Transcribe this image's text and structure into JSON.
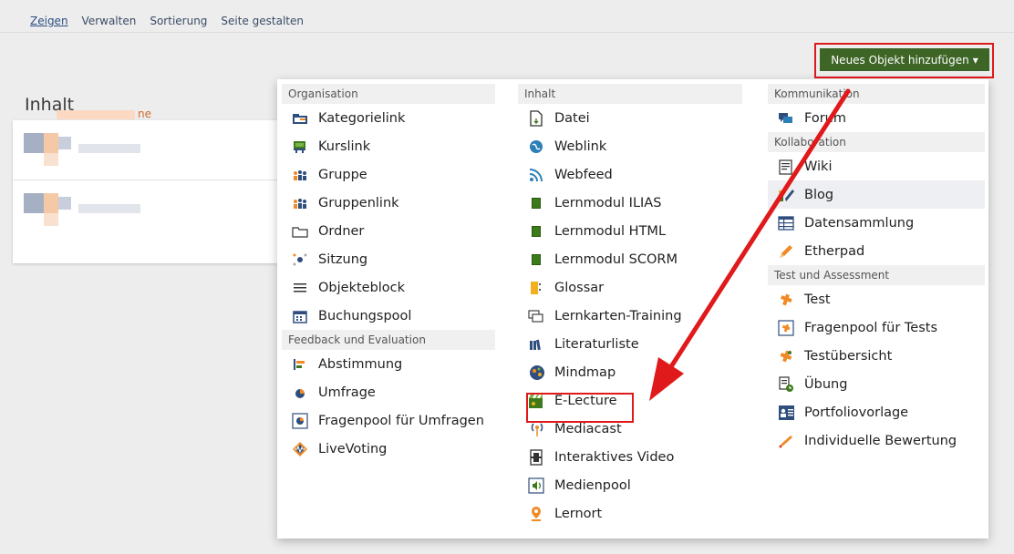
{
  "tabs": [
    "Zeigen",
    "Verwalten",
    "Sortierung",
    "Seite gestalten"
  ],
  "add_button": {
    "label": "Neues Objekt hinzufügen",
    "caret": "▾"
  },
  "page_title": "Inhalt",
  "content_row_suffix": "ne",
  "colors": {
    "accent_button": "#3d6526",
    "highlight": "#e0191b"
  },
  "menu": {
    "col1": [
      {
        "header": "Organisation",
        "items": [
          {
            "label": "Kategorielink",
            "icon": "category-link-icon"
          },
          {
            "label": "Kurslink",
            "icon": "course-link-icon"
          },
          {
            "label": "Gruppe",
            "icon": "group-icon"
          },
          {
            "label": "Gruppenlink",
            "icon": "group-link-icon"
          },
          {
            "label": "Ordner",
            "icon": "folder-icon"
          },
          {
            "label": "Sitzung",
            "icon": "session-icon"
          },
          {
            "label": "Objekteblock",
            "icon": "item-group-icon"
          },
          {
            "label": "Buchungspool",
            "icon": "booking-pool-icon"
          }
        ]
      },
      {
        "header": "Feedback und Evaluation",
        "items": [
          {
            "label": "Abstimmung",
            "icon": "poll-icon"
          },
          {
            "label": "Umfrage",
            "icon": "survey-icon"
          },
          {
            "label": "Fragenpool für Umfragen",
            "icon": "survey-pool-icon"
          },
          {
            "label": "LiveVoting",
            "icon": "live-voting-icon"
          }
        ]
      }
    ],
    "col2": [
      {
        "header": "Inhalt",
        "items": [
          {
            "label": "Datei",
            "icon": "file-icon"
          },
          {
            "label": "Weblink",
            "icon": "weblink-icon"
          },
          {
            "label": "Webfeed",
            "icon": "rss-icon"
          },
          {
            "label": "Lernmodul ILIAS",
            "icon": "learning-module-icon"
          },
          {
            "label": "Lernmodul HTML",
            "icon": "learning-module-icon"
          },
          {
            "label": "Lernmodul SCORM",
            "icon": "learning-module-icon"
          },
          {
            "label": "Glossar",
            "icon": "glossary-icon"
          },
          {
            "label": "Lernkarten-Training",
            "icon": "flashcards-icon"
          },
          {
            "label": "Literaturliste",
            "icon": "bibliography-icon"
          },
          {
            "label": "Mindmap",
            "icon": "mindmap-icon"
          },
          {
            "label": "E-Lecture",
            "icon": "electure-icon"
          },
          {
            "label": "Mediacast",
            "icon": "mediacast-icon"
          },
          {
            "label": "Interaktives Video",
            "icon": "video-icon"
          },
          {
            "label": "Medienpool",
            "icon": "media-pool-icon"
          },
          {
            "label": "Lernort",
            "icon": "location-icon"
          }
        ]
      }
    ],
    "col3": [
      {
        "header": "Kommunikation",
        "items": [
          {
            "label": "Forum",
            "icon": "forum-icon"
          }
        ]
      },
      {
        "header": "Kollaboration",
        "items": [
          {
            "label": "Wiki",
            "icon": "wiki-icon"
          },
          {
            "label": "Blog",
            "icon": "blog-icon"
          },
          {
            "label": "Datensammlung",
            "icon": "data-collection-icon"
          },
          {
            "label": "Etherpad",
            "icon": "etherpad-icon"
          }
        ]
      },
      {
        "header": "Test und Assessment",
        "items": [
          {
            "label": "Test",
            "icon": "test-icon"
          },
          {
            "label": "Fragenpool für Tests",
            "icon": "question-pool-icon"
          },
          {
            "label": "Testübersicht",
            "icon": "test-overview-icon"
          },
          {
            "label": "Übung",
            "icon": "exercise-icon"
          },
          {
            "label": "Portfoliovorlage",
            "icon": "portfolio-template-icon"
          },
          {
            "label": "Individuelle Bewertung",
            "icon": "individual-assessment-icon"
          }
        ]
      }
    ]
  }
}
